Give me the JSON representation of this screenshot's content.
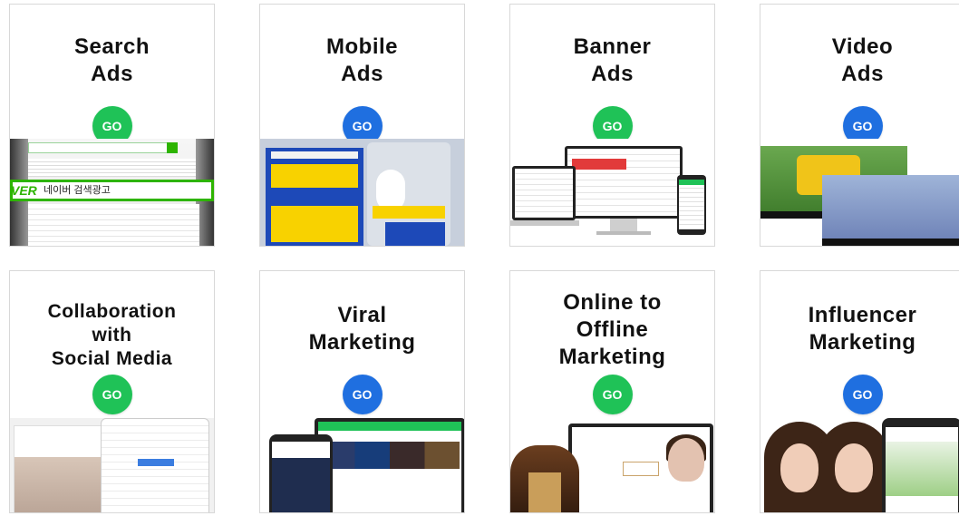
{
  "colors": {
    "go_green": "#1fc257",
    "go_blue": "#1f6fe0",
    "card_border": "#d8d8d8",
    "title_text": "#111111"
  },
  "cards": [
    {
      "title_lines": [
        "Search",
        "Ads"
      ],
      "button_label": "GO",
      "button_color": "green",
      "thumb_texts": {
        "logo_letters": "VER",
        "search_term": "네이버 검색광고"
      }
    },
    {
      "title_lines": [
        "Mobile",
        "Ads"
      ],
      "button_label": "GO",
      "button_color": "blue"
    },
    {
      "title_lines": [
        "Banner",
        "Ads"
      ],
      "button_label": "GO",
      "button_color": "green"
    },
    {
      "title_lines": [
        "Video",
        "Ads"
      ],
      "button_label": "GO",
      "button_color": "blue"
    },
    {
      "title_lines": [
        "Collaboration",
        "with",
        "Social Media"
      ],
      "button_label": "GO",
      "button_color": "green"
    },
    {
      "title_lines": [
        "Viral",
        "Marketing"
      ],
      "button_label": "GO",
      "button_color": "blue"
    },
    {
      "title_lines": [
        "Online to",
        "Offline",
        "Marketing"
      ],
      "button_label": "GO",
      "button_color": "green"
    },
    {
      "title_lines": [
        "Influencer",
        "Marketing"
      ],
      "button_label": "GO",
      "button_color": "blue"
    }
  ]
}
